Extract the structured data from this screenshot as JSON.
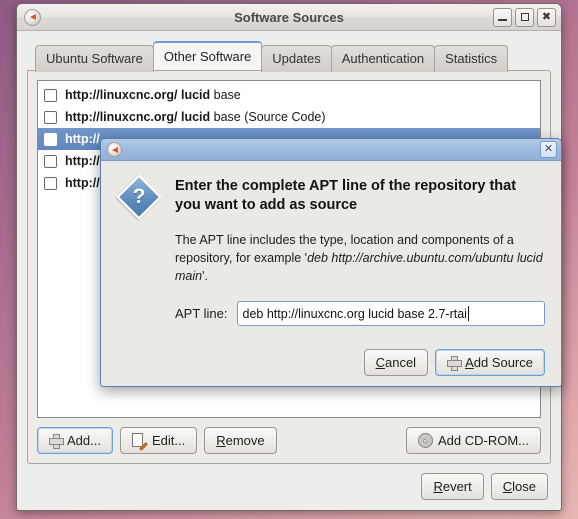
{
  "window": {
    "title": "Software Sources",
    "app_icon": "ubuntu-software-icon",
    "controls": {
      "minimize": "–",
      "maximize": "□",
      "close": "✕"
    }
  },
  "tabs": [
    {
      "label": "Ubuntu Software",
      "active": false
    },
    {
      "label": "Other Software",
      "active": true
    },
    {
      "label": "Updates",
      "active": false
    },
    {
      "label": "Authentication",
      "active": false
    },
    {
      "label": "Statistics",
      "active": false
    }
  ],
  "sources": [
    {
      "url": "http://linuxcnc.org/",
      "dist": "lucid",
      "comps": "base",
      "checked": false,
      "selected": false
    },
    {
      "url": "http://linuxcnc.org/",
      "dist": "lucid",
      "comps": "base (Source Code)",
      "checked": false,
      "selected": false
    },
    {
      "url": "http://",
      "dist": "",
      "comps": "",
      "checked": false,
      "selected": true
    },
    {
      "url": "http://",
      "dist": "",
      "comps": "",
      "checked": false,
      "selected": false
    },
    {
      "url": "http://",
      "dist": "",
      "comps": "",
      "checked": false,
      "selected": false
    }
  ],
  "toolbar": {
    "add_label": "Add...",
    "edit_label": "Edit...",
    "remove_label": "Remove",
    "remove_mnemonic": "R",
    "remove_rest": "emove",
    "add_cdrom_label": "Add CD-ROM..."
  },
  "bottom": {
    "revert_mnemonic": "R",
    "revert_rest": "evert",
    "close_mnemonic": "C",
    "close_rest": "lose"
  },
  "dialog": {
    "titlebar_icon": "ubuntu-software-icon",
    "close_glyph": "✕",
    "icon": "question-diamond-icon",
    "icon_glyph": "?",
    "heading": "Enter the complete APT line of the repository that you want to add as source",
    "body_prefix": "The APT line includes the type, location and components of a repository, for example  '",
    "body_example": "deb http://archive.ubuntu.com/ubuntu lucid main",
    "body_suffix": "'.",
    "apt_label": "APT line:",
    "apt_value": "deb http://linuxcnc.org lucid base 2.7-rtai",
    "apt_placeholder": "",
    "cancel_mnemonic": "C",
    "cancel_rest": "ancel",
    "add_source_mnemonic": "A",
    "add_source_rest": "dd Source"
  }
}
